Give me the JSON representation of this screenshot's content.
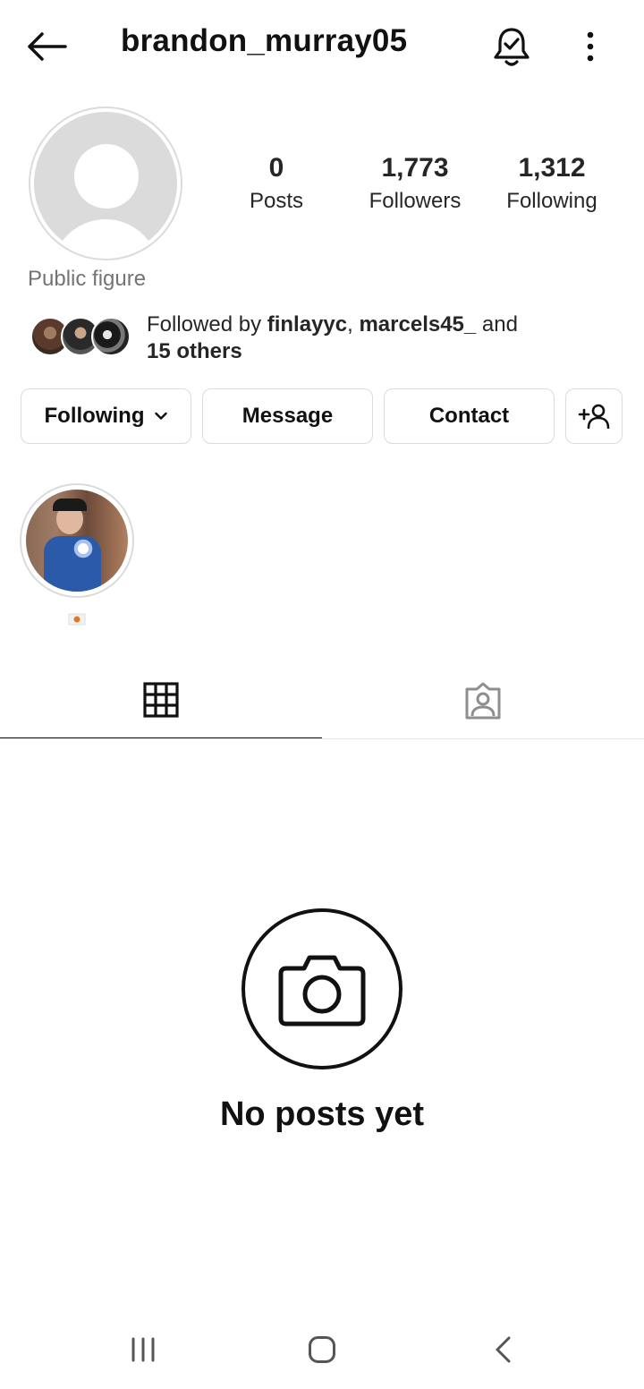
{
  "header": {
    "username": "brandon_murray05",
    "back_icon": "arrow-left-icon",
    "notification_icon": "bell-check-icon",
    "more_icon": "more-vertical-icon"
  },
  "profile": {
    "avatar_icon": "default-avatar-icon",
    "category": "Public figure",
    "stats": {
      "posts": {
        "value": "0",
        "label": "Posts"
      },
      "followers": {
        "value": "1,773",
        "label": "Followers"
      },
      "following": {
        "value": "1,312",
        "label": "Following"
      }
    },
    "followed_by": {
      "prefix": "Followed by ",
      "user1": "finlayyc",
      "separator": ", ",
      "user2": "marcels45_",
      "suffix": " and",
      "others": "15 others"
    }
  },
  "actions": {
    "following_label": "Following",
    "message_label": "Message",
    "contact_label": "Contact",
    "add_user_icon": "add-person-icon"
  },
  "highlights": [
    {
      "label_icon": "flag-emoji-icon"
    }
  ],
  "tabs": {
    "grid_icon": "grid-icon",
    "tagged_icon": "tagged-person-icon",
    "active": "grid"
  },
  "empty_state": {
    "icon": "camera-icon",
    "text": "No posts yet"
  },
  "system_nav": {
    "recent_icon": "recent-apps-icon",
    "home_icon": "home-icon",
    "back_icon": "back-chevron-icon"
  }
}
